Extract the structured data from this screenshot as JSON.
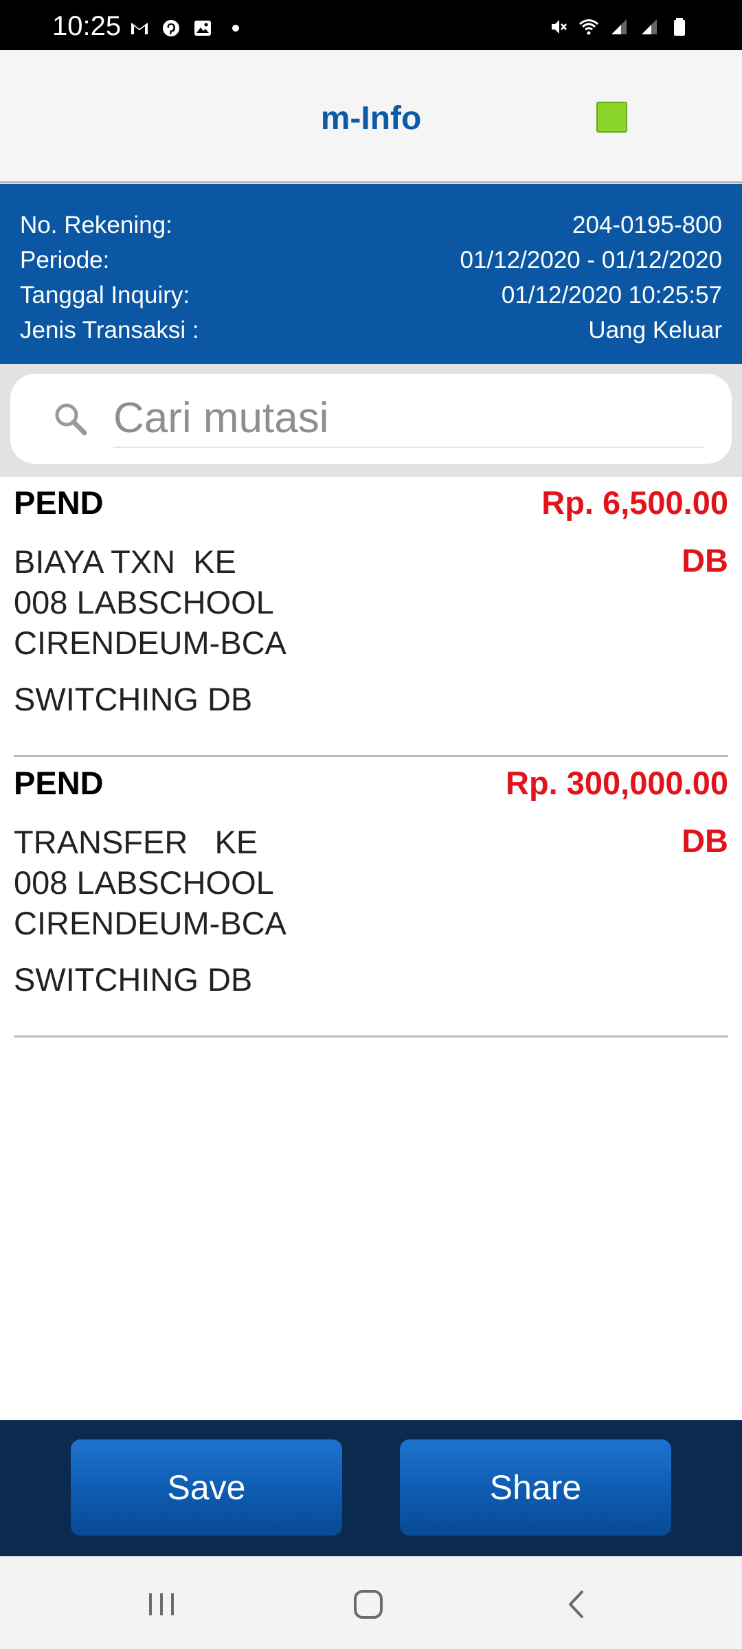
{
  "status_bar": {
    "time": "10:25",
    "left_icons": [
      "gmail-icon",
      "pinterest-icon",
      "gallery-icon",
      "notification-dot-icon"
    ],
    "right_icons": [
      "mute-icon",
      "wifi-icon",
      "signal-icon",
      "signal-icon-2",
      "battery-icon"
    ]
  },
  "header": {
    "title": "m-Info",
    "status_color": "#8bd42a"
  },
  "info": {
    "rows": [
      {
        "label": "No. Rekening:",
        "value": "204-0195-800"
      },
      {
        "label": "Periode:",
        "value": "01/12/2020 - 01/12/2020"
      },
      {
        "label": "Tanggal Inquiry:",
        "value": "01/12/2020 10:25:57"
      },
      {
        "label": "Jenis Transaksi :",
        "value": "Uang Keluar"
      }
    ]
  },
  "search": {
    "placeholder": "Cari mutasi",
    "value": ""
  },
  "transactions": [
    {
      "status": "PEND",
      "amount": "Rp. 6,500.00",
      "description": "BIAYA TXN  KE\n008 LABSCHOOL\nCIRENDEUM-BCA",
      "type": "DB",
      "note": "SWITCHING DB"
    },
    {
      "status": "PEND",
      "amount": "Rp. 300,000.00",
      "description": "TRANSFER   KE\n008 LABSCHOOL\nCIRENDEUM-BCA",
      "type": "DB",
      "note": "SWITCHING DB"
    }
  ],
  "actions": {
    "save_label": "Save",
    "share_label": "Share"
  },
  "colors": {
    "brand_blue": "#0b57a3",
    "debit_red": "#e0141a",
    "action_bar": "#0a2a4f"
  }
}
